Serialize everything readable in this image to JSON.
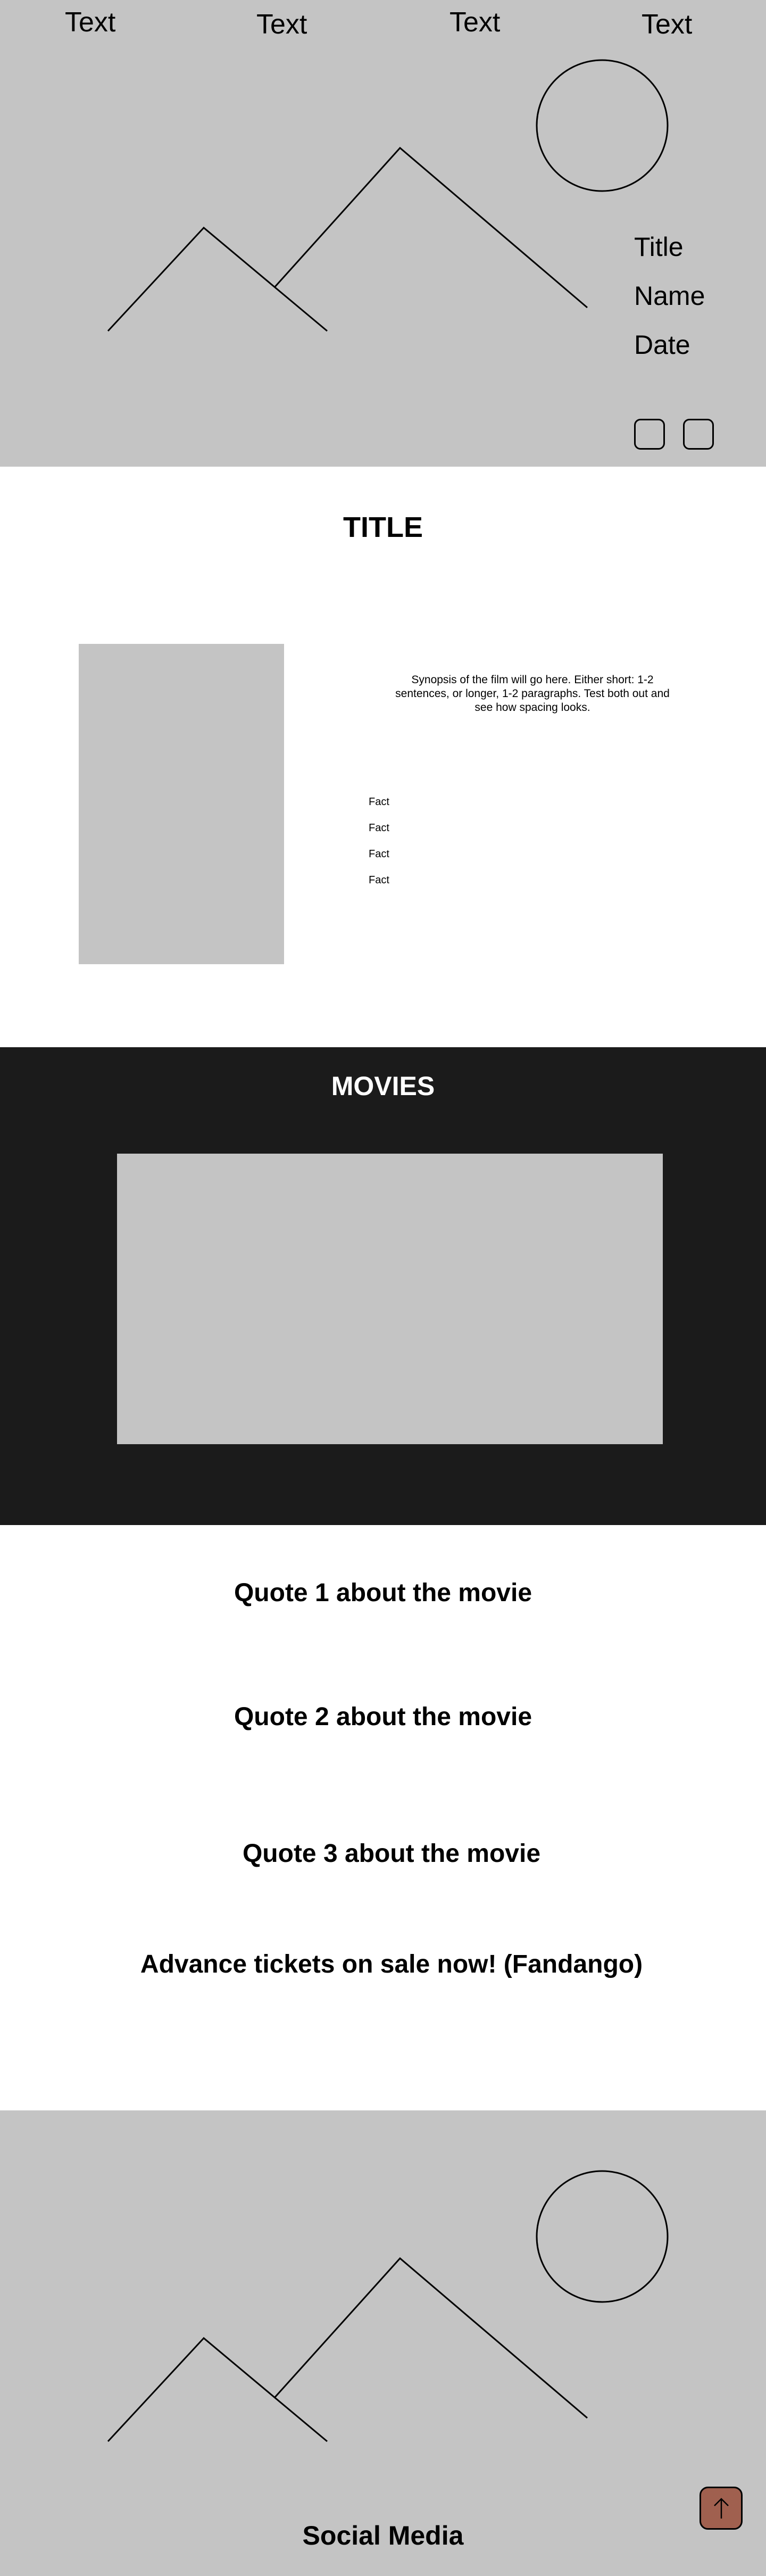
{
  "nav": {
    "items": [
      "Text",
      "Text",
      "Text",
      "Text"
    ]
  },
  "hero": {
    "title": "Title",
    "name": "Name",
    "date": "Date",
    "buttons": [
      "button-1",
      "button-2"
    ]
  },
  "synopsis": {
    "title": "TITLE",
    "text": "Synopsis of the film will go here. Either short: 1-2 sentences, or longer, 1-2 paragraphs. Test both out and see how spacing looks.",
    "facts": [
      "Fact",
      "Fact",
      "Fact",
      "Fact"
    ]
  },
  "movies": {
    "title": "MOVIES"
  },
  "quotes": {
    "items": [
      "Quote 1 about the movie",
      "Quote 2 about the movie",
      "Quote 3 about the movie"
    ],
    "tickets": "Advance tickets on sale now! (Fandango)"
  },
  "footer": {
    "social": "Social Media",
    "top_button_icon": "arrow-up-icon",
    "top_button_color": "#a0604f"
  },
  "colors": {
    "placeholder": "#c4c4c4",
    "dark_section": "#1b1b1b"
  }
}
